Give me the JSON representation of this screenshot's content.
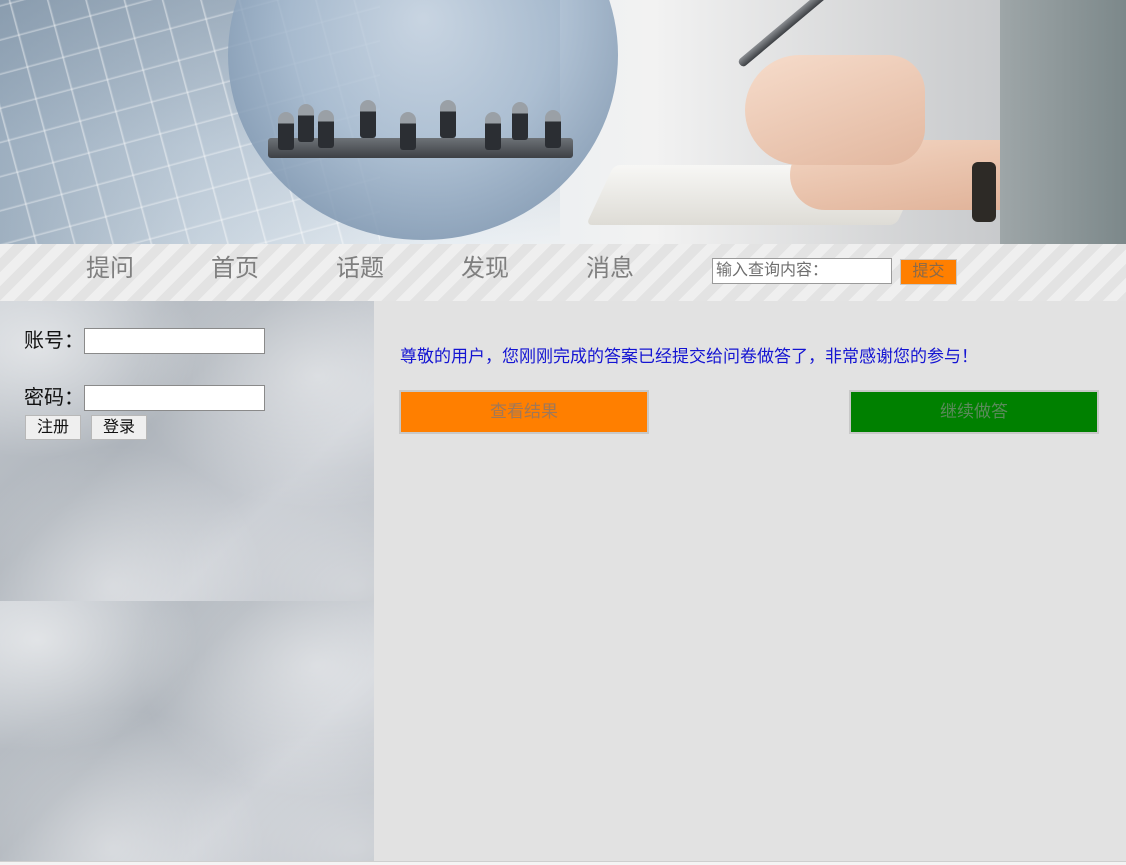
{
  "nav": {
    "items": [
      {
        "label": "提问"
      },
      {
        "label": "首页"
      },
      {
        "label": "话题"
      },
      {
        "label": "发现"
      },
      {
        "label": "消息"
      }
    ],
    "search": {
      "value": "",
      "placeholder": "输入查询内容："
    },
    "submit_label": "提交"
  },
  "login": {
    "account_label": "账号：",
    "account_value": "",
    "password_label": "密码：",
    "password_value": "",
    "register_label": "注册",
    "login_label": "登录"
  },
  "main": {
    "message": "尊敬的用户，您刚刚完成的答案已经提交给问卷做答了，非常感谢您的参与！",
    "view_results_label": "查看结果",
    "continue_label": "继续做答"
  },
  "colors": {
    "accent_orange": "#ff7f00",
    "accent_green": "#008000",
    "message_blue": "#1414d2",
    "panel_gray": "#e2e2e2"
  },
  "banner": {
    "image": "business-meeting-banner"
  }
}
